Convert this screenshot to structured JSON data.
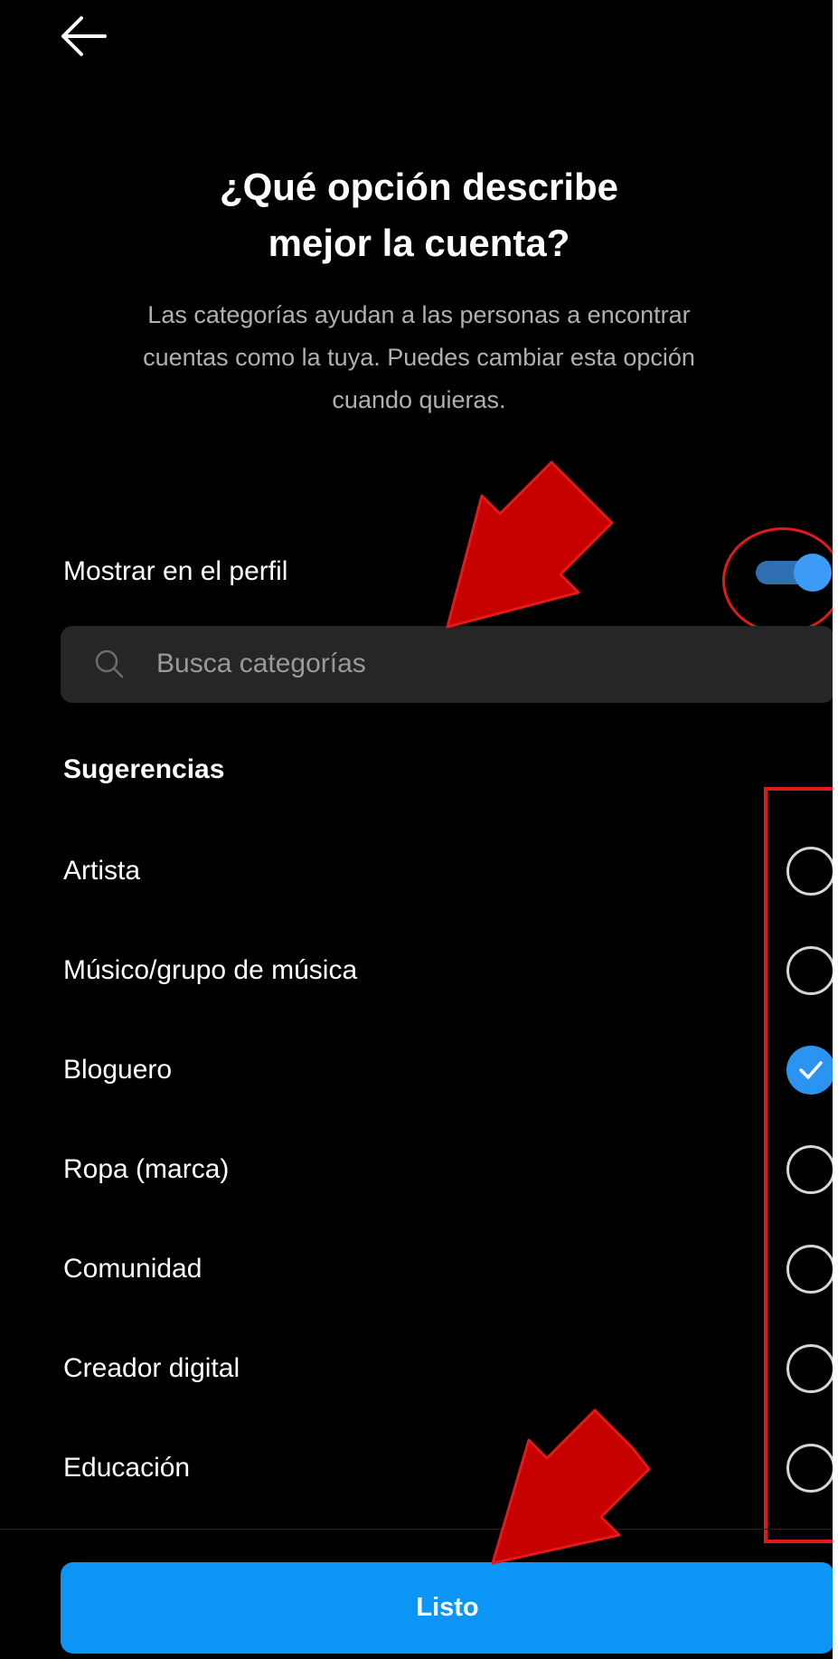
{
  "header": {
    "back_icon": "arrow-left-icon",
    "title": "¿Qué opción describe\nmejor la cuenta?",
    "subtitle": "Las categorías ayudan a las personas a encontrar\ncuentas como la tuya. Puedes cambiar esta opción\ncuando quieras."
  },
  "show_on_profile": {
    "label": "Mostrar en el perfil",
    "enabled": true
  },
  "search": {
    "icon": "search-icon",
    "placeholder": "Busca categorías"
  },
  "suggestions": {
    "heading": "Sugerencias",
    "items": [
      {
        "label": "Artista",
        "selected": false
      },
      {
        "label": "Músico/grupo de música",
        "selected": false
      },
      {
        "label": "Bloguero",
        "selected": true
      },
      {
        "label": "Ropa (marca)",
        "selected": false
      },
      {
        "label": "Comunidad",
        "selected": false
      },
      {
        "label": "Creador digital",
        "selected": false
      },
      {
        "label": "Educación",
        "selected": false
      }
    ]
  },
  "footer": {
    "done_label": "Listo"
  },
  "colors": {
    "background": "#000000",
    "accent": "#0a95f7",
    "toggle_knob": "#3c9bf7",
    "toggle_track": "#2f6fb2",
    "annotation": "#e01b1b",
    "search_bg": "#262626"
  }
}
